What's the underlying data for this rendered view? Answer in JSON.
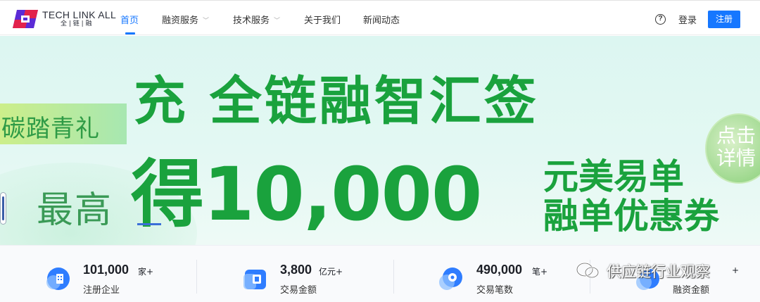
{
  "header": {
    "logo_main": "TECH LINK ALL",
    "logo_sub": "全 | 链 | 融",
    "nav": [
      {
        "label": "首页",
        "active": true
      },
      {
        "label": "融资服务",
        "dropdown": true
      },
      {
        "label": "技术服务",
        "dropdown": true
      },
      {
        "label": "关于我们"
      },
      {
        "label": "新闻动态"
      }
    ],
    "help_icon": "?",
    "login": "登录",
    "register": "注册"
  },
  "banner": {
    "tag": "碳踏青礼",
    "headline": "充 全链融智汇签",
    "max_label": "最高",
    "amount": "得10,000",
    "coupon_line1": "元美易单",
    "coupon_line2": "融单优惠券",
    "detail_button": "点击\n详情"
  },
  "stats": [
    {
      "value": "101,000",
      "unit": "家+",
      "label": "注册企业",
      "icon": "building-icon"
    },
    {
      "value": "3,800",
      "unit": "亿元+",
      "label": "交易金额",
      "icon": "wallet-icon"
    },
    {
      "value": "490,000",
      "unit": "笔+",
      "label": "交易笔数",
      "icon": "coin-icon"
    },
    {
      "value": "",
      "unit": "+",
      "label": "融资金额",
      "icon": "finance-icon"
    }
  ],
  "watermark": "供应链行业观察",
  "colors": {
    "accent": "#1677ff",
    "banner_green": "#1aa23d",
    "banner_bg": "#dcf6f1"
  }
}
